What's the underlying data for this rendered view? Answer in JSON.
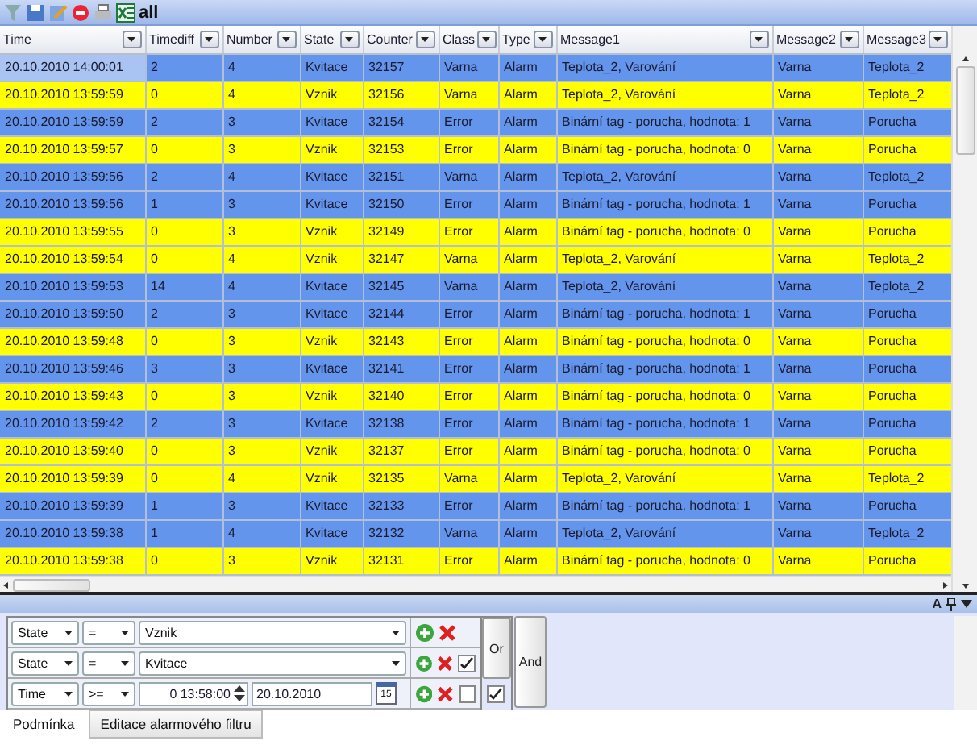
{
  "toolbar": {
    "label": "all"
  },
  "table": {
    "columns": [
      "Time",
      "Timediff",
      "Number",
      "State",
      "Counter",
      "Class",
      "Type",
      "Message1",
      "Message2",
      "Message3"
    ],
    "rows": [
      {
        "selected": true,
        "color": "#6495ed",
        "cells": [
          "20.10.2010 14:00:01",
          "2",
          "4",
          "Kvitace",
          "32157",
          "Varna",
          "Alarm",
          "Teplota_2, Varování",
          "Varna",
          "Teplota_2"
        ]
      },
      {
        "selected": false,
        "color": "#ffff00",
        "cells": [
          "20.10.2010 13:59:59",
          "0",
          "4",
          "Vznik",
          "32156",
          "Varna",
          "Alarm",
          "Teplota_2, Varování",
          "Varna",
          "Teplota_2"
        ]
      },
      {
        "selected": false,
        "color": "#6495ed",
        "cells": [
          "20.10.2010 13:59:59",
          "2",
          "3",
          "Kvitace",
          "32154",
          "Error",
          "Alarm",
          "Binární tag - porucha, hodnota: 1",
          "Varna",
          "Porucha"
        ]
      },
      {
        "selected": false,
        "color": "#ffff00",
        "cells": [
          "20.10.2010 13:59:57",
          "0",
          "3",
          "Vznik",
          "32153",
          "Error",
          "Alarm",
          "Binární tag - porucha, hodnota: 0",
          "Varna",
          "Porucha"
        ]
      },
      {
        "selected": false,
        "color": "#6495ed",
        "cells": [
          "20.10.2010 13:59:56",
          "2",
          "4",
          "Kvitace",
          "32151",
          "Varna",
          "Alarm",
          "Teplota_2, Varování",
          "Varna",
          "Teplota_2"
        ]
      },
      {
        "selected": false,
        "color": "#6495ed",
        "cells": [
          "20.10.2010 13:59:56",
          "1",
          "3",
          "Kvitace",
          "32150",
          "Error",
          "Alarm",
          "Binární tag - porucha, hodnota: 1",
          "Varna",
          "Porucha"
        ]
      },
      {
        "selected": false,
        "color": "#ffff00",
        "cells": [
          "20.10.2010 13:59:55",
          "0",
          "3",
          "Vznik",
          "32149",
          "Error",
          "Alarm",
          "Binární tag - porucha, hodnota: 0",
          "Varna",
          "Porucha"
        ]
      },
      {
        "selected": false,
        "color": "#ffff00",
        "cells": [
          "20.10.2010 13:59:54",
          "0",
          "4",
          "Vznik",
          "32147",
          "Varna",
          "Alarm",
          "Teplota_2, Varování",
          "Varna",
          "Teplota_2"
        ]
      },
      {
        "selected": false,
        "color": "#6495ed",
        "cells": [
          "20.10.2010 13:59:53",
          "14",
          "4",
          "Kvitace",
          "32145",
          "Varna",
          "Alarm",
          "Teplota_2, Varování",
          "Varna",
          "Teplota_2"
        ]
      },
      {
        "selected": false,
        "color": "#6495ed",
        "cells": [
          "20.10.2010 13:59:50",
          "2",
          "3",
          "Kvitace",
          "32144",
          "Error",
          "Alarm",
          "Binární tag - porucha, hodnota: 1",
          "Varna",
          "Porucha"
        ]
      },
      {
        "selected": false,
        "color": "#ffff00",
        "cells": [
          "20.10.2010 13:59:48",
          "0",
          "3",
          "Vznik",
          "32143",
          "Error",
          "Alarm",
          "Binární tag - porucha, hodnota: 0",
          "Varna",
          "Porucha"
        ]
      },
      {
        "selected": false,
        "color": "#6495ed",
        "cells": [
          "20.10.2010 13:59:46",
          "3",
          "3",
          "Kvitace",
          "32141",
          "Error",
          "Alarm",
          "Binární tag - porucha, hodnota: 1",
          "Varna",
          "Porucha"
        ]
      },
      {
        "selected": false,
        "color": "#ffff00",
        "cells": [
          "20.10.2010 13:59:43",
          "0",
          "3",
          "Vznik",
          "32140",
          "Error",
          "Alarm",
          "Binární tag - porucha, hodnota: 0",
          "Varna",
          "Porucha"
        ]
      },
      {
        "selected": false,
        "color": "#6495ed",
        "cells": [
          "20.10.2010 13:59:42",
          "2",
          "3",
          "Kvitace",
          "32138",
          "Error",
          "Alarm",
          "Binární tag - porucha, hodnota: 1",
          "Varna",
          "Porucha"
        ]
      },
      {
        "selected": false,
        "color": "#ffff00",
        "cells": [
          "20.10.2010 13:59:40",
          "0",
          "3",
          "Vznik",
          "32137",
          "Error",
          "Alarm",
          "Binární tag - porucha, hodnota: 0",
          "Varna",
          "Porucha"
        ]
      },
      {
        "selected": false,
        "color": "#ffff00",
        "cells": [
          "20.10.2010 13:59:39",
          "0",
          "4",
          "Vznik",
          "32135",
          "Varna",
          "Alarm",
          "Teplota_2, Varování",
          "Varna",
          "Teplota_2"
        ]
      },
      {
        "selected": false,
        "color": "#6495ed",
        "cells": [
          "20.10.2010 13:59:39",
          "1",
          "3",
          "Kvitace",
          "32133",
          "Error",
          "Alarm",
          "Binární tag - porucha, hodnota: 1",
          "Varna",
          "Porucha"
        ]
      },
      {
        "selected": false,
        "color": "#6495ed",
        "cells": [
          "20.10.2010 13:59:38",
          "1",
          "4",
          "Kvitace",
          "32132",
          "Varna",
          "Alarm",
          "Teplota_2, Varování",
          "Varna",
          "Teplota_2"
        ]
      },
      {
        "selected": false,
        "color": "#ffff00",
        "cells": [
          "20.10.2010 13:59:38",
          "0",
          "3",
          "Vznik",
          "32131",
          "Error",
          "Alarm",
          "Binární tag - porucha, hodnota: 0",
          "Varna",
          "Porucha"
        ]
      }
    ]
  },
  "panel_header": {
    "font_button": "A"
  },
  "filter": {
    "conditions": [
      {
        "kind": "select",
        "field": "State",
        "operator": "=",
        "value": "Vznik"
      },
      {
        "kind": "select",
        "field": "State",
        "operator": "=",
        "value": "Kvitace",
        "checked": true
      },
      {
        "kind": "time",
        "field": "Time",
        "operator": ">=",
        "value": "0 13:58:00",
        "date": "20.10.2010",
        "calendar_day": "15",
        "checked": false
      }
    ],
    "or_button": "Or",
    "or_checked": true,
    "and_button": "And"
  },
  "tabs": [
    {
      "label": "Podmínka",
      "selected": true
    },
    {
      "label": "Editace alarmového filtru",
      "selected": false
    }
  ]
}
